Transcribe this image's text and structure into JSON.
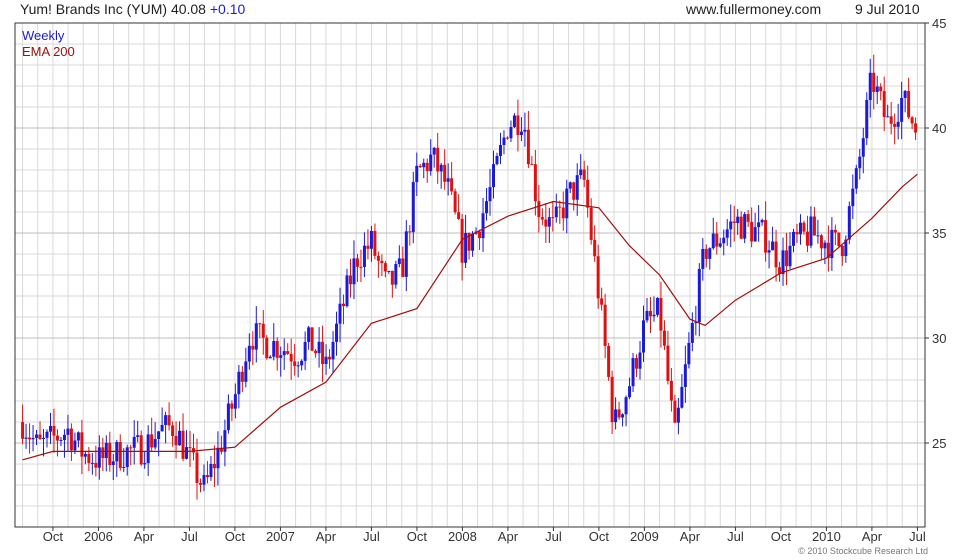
{
  "header": {
    "title": "Yum! Brands Inc (YUM)",
    "price": "40.08",
    "change": "+0.10",
    "source": "www.fullermoney.com",
    "date": "9 Jul 2010"
  },
  "legend": {
    "weekly": "Weekly",
    "ema": "EMA 200"
  },
  "footer": "© 2010 Stockcube Research Ltd",
  "colors": {
    "up": "#1a1ad8",
    "down": "#e01010",
    "ema": "#a01010",
    "grid": "#d9d9d9",
    "axis": "#333333"
  },
  "chart_data": {
    "type": "candlestick",
    "interval": "weekly",
    "x_range": [
      "2005-08",
      "2010-07"
    ],
    "ylim": [
      21,
      45
    ],
    "y_ticks": [
      25,
      30,
      35,
      40,
      45
    ],
    "x_ticks": [
      {
        "label": "Oct",
        "date": "2005-10"
      },
      {
        "label": "2006",
        "date": "2006-01"
      },
      {
        "label": "Apr",
        "date": "2006-04"
      },
      {
        "label": "Jul",
        "date": "2006-07"
      },
      {
        "label": "Oct",
        "date": "2006-10"
      },
      {
        "label": "2007",
        "date": "2007-01"
      },
      {
        "label": "Apr",
        "date": "2007-04"
      },
      {
        "label": "Jul",
        "date": "2007-07"
      },
      {
        "label": "Oct",
        "date": "2007-10"
      },
      {
        "label": "2008",
        "date": "2008-01"
      },
      {
        "label": "Apr",
        "date": "2008-04"
      },
      {
        "label": "Jul",
        "date": "2008-07"
      },
      {
        "label": "Oct",
        "date": "2008-10"
      },
      {
        "label": "2009",
        "date": "2009-01"
      },
      {
        "label": "Apr",
        "date": "2009-04"
      },
      {
        "label": "Jul",
        "date": "2009-07"
      },
      {
        "label": "Oct",
        "date": "2009-10"
      },
      {
        "label": "2010",
        "date": "2010-01"
      },
      {
        "label": "Apr",
        "date": "2010-04"
      },
      {
        "label": "Jul",
        "date": "2010-07"
      }
    ],
    "price_path": [
      [
        "2005-08",
        26.0
      ],
      [
        "2005-09",
        24.8
      ],
      [
        "2005-10",
        25.2
      ],
      [
        "2005-11",
        25.6
      ],
      [
        "2005-12",
        24.5
      ],
      [
        "2006-01",
        24.2
      ],
      [
        "2006-02",
        24.4
      ],
      [
        "2006-03",
        24.6
      ],
      [
        "2006-04",
        24.8
      ],
      [
        "2006-05",
        25.6
      ],
      [
        "2006-06",
        25.8
      ],
      [
        "2006-07",
        24.2
      ],
      [
        "2006-08",
        22.8
      ],
      [
        "2006-09",
        24.8
      ],
      [
        "2006-10",
        27.2
      ],
      [
        "2006-11",
        30.2
      ],
      [
        "2006-12",
        29.8
      ],
      [
        "2007-01",
        29.6
      ],
      [
        "2007-02",
        29.2
      ],
      [
        "2007-03",
        29.8
      ],
      [
        "2007-04",
        28.6
      ],
      [
        "2007-05",
        31.2
      ],
      [
        "2007-06",
        33.8
      ],
      [
        "2007-07",
        34.5
      ],
      [
        "2007-08",
        32.4
      ],
      [
        "2007-09",
        33.2
      ],
      [
        "2007-10",
        37.8
      ],
      [
        "2007-11",
        38.6
      ],
      [
        "2007-12",
        37.2
      ],
      [
        "2008-01",
        34.2
      ],
      [
        "2008-02",
        35.2
      ],
      [
        "2008-03",
        37.4
      ],
      [
        "2008-04",
        40.2
      ],
      [
        "2008-05",
        40.6
      ],
      [
        "2008-06",
        36.2
      ],
      [
        "2008-07",
        35.2
      ],
      [
        "2008-08",
        36.8
      ],
      [
        "2008-09",
        37.6
      ],
      [
        "2008-10",
        32.0
      ],
      [
        "2008-11",
        25.8
      ],
      [
        "2008-12",
        27.8
      ],
      [
        "2009-01",
        30.6
      ],
      [
        "2009-02",
        31.2
      ],
      [
        "2009-03",
        25.2
      ],
      [
        "2009-04",
        29.8
      ],
      [
        "2009-05",
        34.2
      ],
      [
        "2009-06",
        34.8
      ],
      [
        "2009-07",
        35.6
      ],
      [
        "2009-08",
        35.2
      ],
      [
        "2009-09",
        34.8
      ],
      [
        "2009-10",
        33.6
      ],
      [
        "2009-11",
        34.6
      ],
      [
        "2009-12",
        35.0
      ],
      [
        "2010-01",
        34.6
      ],
      [
        "2010-02",
        34.4
      ],
      [
        "2010-03",
        37.6
      ],
      [
        "2010-04",
        42.4
      ],
      [
        "2010-05",
        40.2
      ],
      [
        "2010-06",
        41.4
      ],
      [
        "2010-07",
        39.8
      ]
    ],
    "ema_path": [
      [
        "2005-08",
        24.2
      ],
      [
        "2005-10",
        24.6
      ],
      [
        "2006-01",
        24.6
      ],
      [
        "2006-04",
        24.6
      ],
      [
        "2006-07",
        24.6
      ],
      [
        "2006-10",
        24.8
      ],
      [
        "2007-01",
        26.7
      ],
      [
        "2007-04",
        27.9
      ],
      [
        "2007-07",
        30.7
      ],
      [
        "2007-10",
        31.4
      ],
      [
        "2008-01",
        34.7
      ],
      [
        "2008-04",
        35.8
      ],
      [
        "2008-07",
        36.5
      ],
      [
        "2008-10",
        36.2
      ],
      [
        "2008-12",
        34.4
      ],
      [
        "2009-02",
        33.0
      ],
      [
        "2009-04",
        30.9
      ],
      [
        "2009-05",
        30.6
      ],
      [
        "2009-07",
        31.8
      ],
      [
        "2009-10",
        33.1
      ],
      [
        "2010-01",
        33.8
      ],
      [
        "2010-04",
        35.7
      ],
      [
        "2010-06",
        37.2
      ],
      [
        "2010-07",
        37.8
      ]
    ]
  }
}
